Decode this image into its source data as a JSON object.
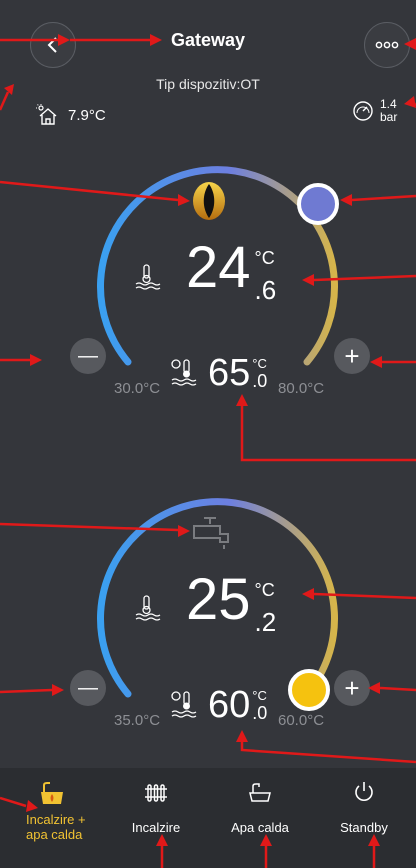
{
  "header": {
    "title": "Gateway",
    "device_type": "Tip dispozitiv:OT",
    "back_icon": "chevron-left-icon",
    "menu_icon": "more-dots-icon"
  },
  "outdoor": {
    "temperature": "7.9°C",
    "icon": "house-sun-icon"
  },
  "pressure": {
    "value": "1.4",
    "unit": "bar",
    "icon": "gauge-icon"
  },
  "heating": {
    "status_icon": "flame-eye-icon",
    "current_int": "24",
    "current_dec": ".6",
    "unit": "°C",
    "setpoint_int": "65",
    "setpoint_dec": ".0",
    "setpoint_unit": "°C",
    "min_label": "30.0°C",
    "max_label": "80.0°C",
    "minus_label": "—",
    "plus_label": "+"
  },
  "hot_water": {
    "status_icon": "tap-icon",
    "current_int": "25",
    "current_dec": ".2",
    "unit": "°C",
    "setpoint_int": "60",
    "setpoint_dec": ".0",
    "setpoint_unit": "°C",
    "min_label": "35.0°C",
    "max_label": "60.0°C",
    "minus_label": "—",
    "plus_label": "+"
  },
  "tabs": [
    {
      "label": "Incalzire + apa calda",
      "icon": "heating-water-icon",
      "active": true
    },
    {
      "label": "Incalzire",
      "icon": "radiator-icon",
      "active": false
    },
    {
      "label": "Apa calda",
      "icon": "bathtub-icon",
      "active": false
    },
    {
      "label": "Standby",
      "icon": "power-icon",
      "active": false
    }
  ],
  "colors": {
    "accent": "#f1c232",
    "arrow": "#e01919",
    "arc_start": "#3aa0f0",
    "arc_end": "#d6b54a"
  }
}
